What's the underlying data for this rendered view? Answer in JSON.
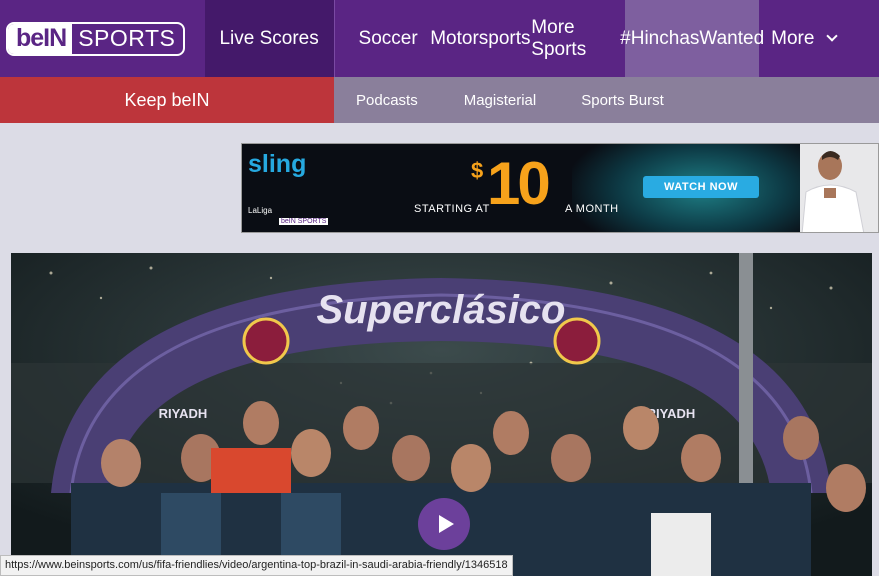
{
  "brand": {
    "logo_left": "beIN",
    "logo_right": "SPORTS"
  },
  "nav": {
    "live_scores": "Live Scores",
    "soccer": "Soccer",
    "motorsports": "Motorsports",
    "more_sports": "More Sports",
    "hinchas": "#HinchasWanted",
    "more": "More"
  },
  "subnav": {
    "keep": "Keep beIN",
    "podcasts": "Podcasts",
    "magisterial": "Magisterial",
    "sports_burst": "Sports Burst"
  },
  "ad": {
    "brand": "sling",
    "laliga": "LaLiga",
    "bein_small": "beIN SPORTS",
    "starting_at": "STARTING AT",
    "dollar": "$",
    "price": "10",
    "per": "A MONTH",
    "cta": "WATCH NOW"
  },
  "hero": {
    "arch_text": "Superclásico",
    "city": "RIYADH"
  },
  "status_url": "https://www.beinsports.com/us/fifa-friendlies/video/argentina-top-brazil-in-saudi-arabia-friendly/1346518",
  "colors": {
    "nav_purple": "#5a2584",
    "live_scores_bg": "#44196a",
    "active_tab_bg": "#7e5f9f",
    "keep_red": "#bd353b",
    "subnav_gray": "#8a7f9b",
    "sling_blue": "#26a9e0",
    "price_orange": "#f7a21b"
  }
}
